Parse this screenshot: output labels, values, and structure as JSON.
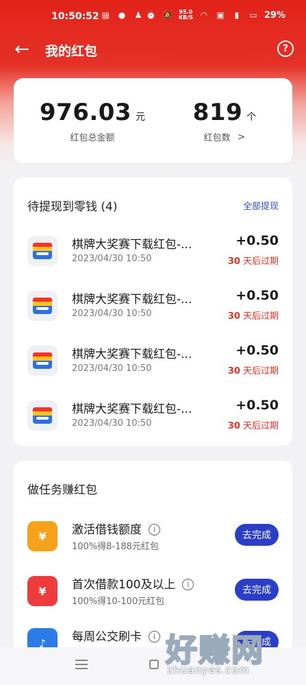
{
  "status_bar": {
    "time": "10:50:52",
    "speed_value": "95.0",
    "speed_unit": "KB/S",
    "battery": "29%"
  },
  "header": {
    "title": "我的红包",
    "help_symbol": "?"
  },
  "summary": {
    "amount_value": "976.03",
    "amount_unit": "元",
    "amount_label": "红包总金额",
    "count_value": "819",
    "count_unit": "个",
    "count_label": "红包数"
  },
  "pending": {
    "title": "待提现到零钱 (4)",
    "withdraw_all": "全部提现",
    "items": [
      {
        "title": "棋牌大奖赛下载红包-...",
        "date": "2023/04/30 10:50",
        "amount": "+0.50",
        "expire_days": "30",
        "expire_text": "天后过期"
      },
      {
        "title": "棋牌大奖赛下载红包-...",
        "date": "2023/04/30 10:50",
        "amount": "+0.50",
        "expire_days": "30",
        "expire_text": "天后过期"
      },
      {
        "title": "棋牌大奖赛下载红包-...",
        "date": "2023/04/30 10:50",
        "amount": "+0.50",
        "expire_days": "30",
        "expire_text": "天后过期"
      },
      {
        "title": "棋牌大奖赛下载红包-...",
        "date": "2023/04/30 10:50",
        "amount": "+0.50",
        "expire_days": "30",
        "expire_text": "天后过期"
      }
    ]
  },
  "tasks": {
    "title": "做任务赚红包",
    "items": [
      {
        "title": "激活借钱额度",
        "subtitle": "100%得8-188元红包",
        "button": "去完成",
        "icon_glyph": "¥",
        "icon_color": "#f7a21b"
      },
      {
        "title": "首次借款100及以上",
        "subtitle": "100%得10-100元红包",
        "button": "去完成",
        "icon_glyph": "¥",
        "icon_color": "#ef3b3b"
      },
      {
        "title": "每周公交刷卡",
        "subtitle": "",
        "button": "去完成",
        "icon_glyph": "♪",
        "icon_color": "#2b7be8"
      }
    ]
  },
  "watermark": {
    "big": "好赚网",
    "small": "zhuanyes.com"
  },
  "colors": {
    "brand_red": "#e53127",
    "button_blue": "#2a3ec7",
    "link_blue": "#3050c0"
  }
}
